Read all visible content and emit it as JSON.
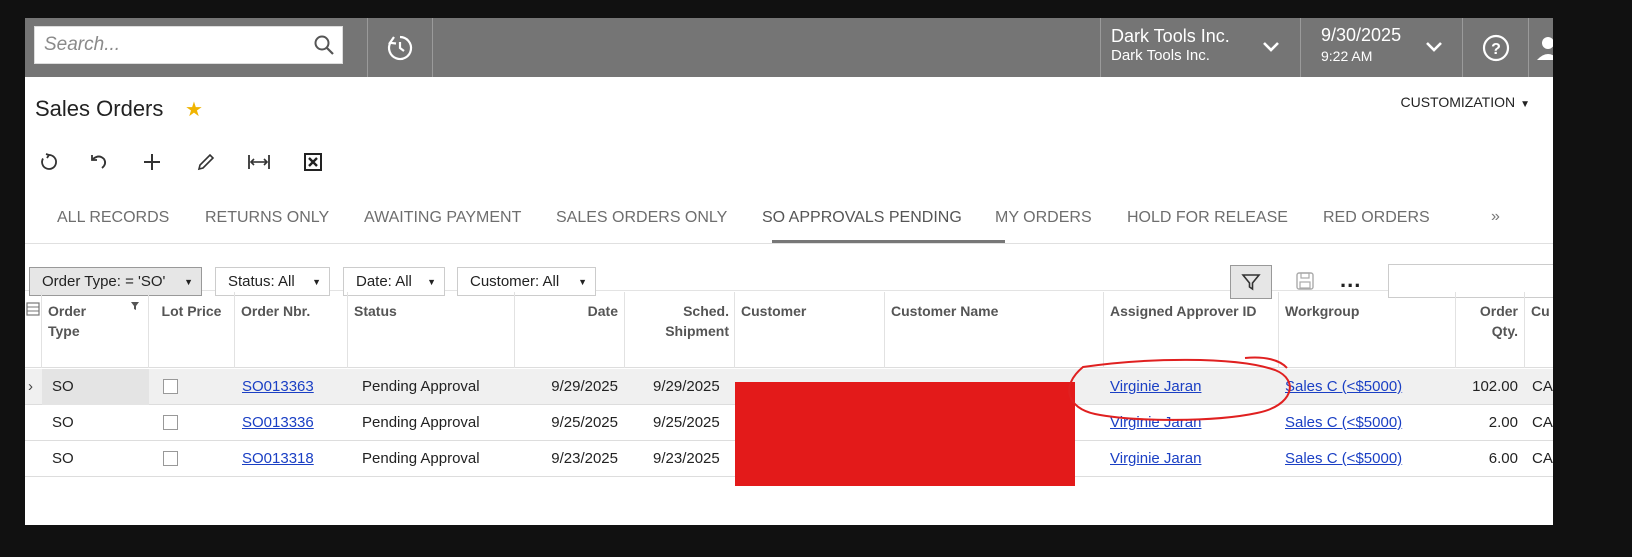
{
  "topbar": {
    "search_placeholder": "Search...",
    "company_name": "Dark Tools Inc.",
    "company_branch": "Dark Tools Inc.",
    "date": "9/30/2025",
    "time": "9:22 AM"
  },
  "page": {
    "title": "Sales Orders",
    "customization_label": "CUSTOMIZATION"
  },
  "toolbar": {
    "icons": [
      "refresh-icon",
      "undo-icon",
      "add-icon",
      "edit-icon",
      "fit-to-screen-icon",
      "export-excel-icon"
    ]
  },
  "tabs": {
    "all_records": "ALL RECORDS",
    "returns_only": "RETURNS ONLY",
    "awaiting_payment": "AWAITING PAYMENT",
    "sales_orders_only": "SALES ORDERS ONLY",
    "so_approvals_pending": "SO APPROVALS PENDING",
    "my_orders": "MY ORDERS",
    "hold_for_release": "HOLD FOR RELEASE",
    "red_orders": "RED ORDERS",
    "active": "SO APPROVALS PENDING"
  },
  "filters": {
    "order_type": "Order Type: = 'SO'",
    "status": "Status: All",
    "date": "Date: All",
    "customer": "Customer: All"
  },
  "grid": {
    "headers": {
      "order_type": "Order Type",
      "lot_price": "Lot Price",
      "order_nbr": "Order Nbr.",
      "status": "Status",
      "date": "Date",
      "sched_shipment": "Sched. Shipment",
      "customer": "Customer",
      "customer_name": "Customer Name",
      "assigned_approver": "Assigned Approver ID",
      "workgroup": "Workgroup",
      "order_qty": "Order Qty.",
      "cu": "Cu"
    },
    "rows": [
      {
        "order_type": "SO",
        "order_nbr": "SO013363",
        "status": "Pending Approval",
        "date": "9/29/2025",
        "sched": "9/29/2025",
        "approver": "Virginie Jaran",
        "workgroup": "Sales C (<$5000)",
        "qty": "102.00",
        "cu": "CA"
      },
      {
        "order_type": "SO",
        "order_nbr": "SO013336",
        "status": "Pending Approval",
        "date": "9/25/2025",
        "sched": "9/25/2025",
        "approver": "Virginie Jaran",
        "workgroup": "Sales C (<$5000)",
        "qty": "2.00",
        "cu": "CA"
      },
      {
        "order_type": "SO",
        "order_nbr": "SO013318",
        "status": "Pending Approval",
        "date": "9/23/2025",
        "sched": "9/23/2025",
        "approver": "Virginie Jaran",
        "workgroup": "Sales C (<$5000)",
        "qty": "6.00",
        "cu": "CA"
      }
    ]
  },
  "colors": {
    "topbar": "#757575",
    "link": "#1a3fc4",
    "redaction": "#e31a1a",
    "annotation": "#e02020",
    "star": "#f0b400"
  }
}
